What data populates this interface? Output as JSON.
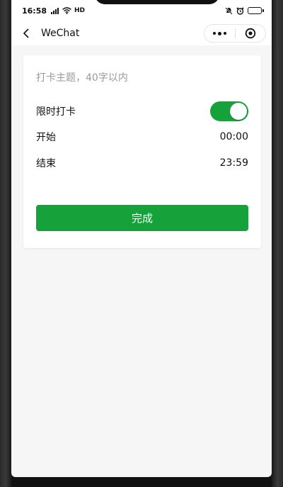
{
  "status_bar": {
    "time": "16:58",
    "network": "HD"
  },
  "nav": {
    "title": "WeChat"
  },
  "form": {
    "topic_placeholder": "打卡主题，40字以内",
    "topic_value": "",
    "time_limit_label": "限时打卡",
    "time_limit_enabled": true,
    "start_label": "开始",
    "start_value": "00:00",
    "end_label": "结束",
    "end_value": "23:59",
    "done_label": "完成"
  },
  "colors": {
    "accent": "#16a23b",
    "battery": "#f4c430"
  }
}
